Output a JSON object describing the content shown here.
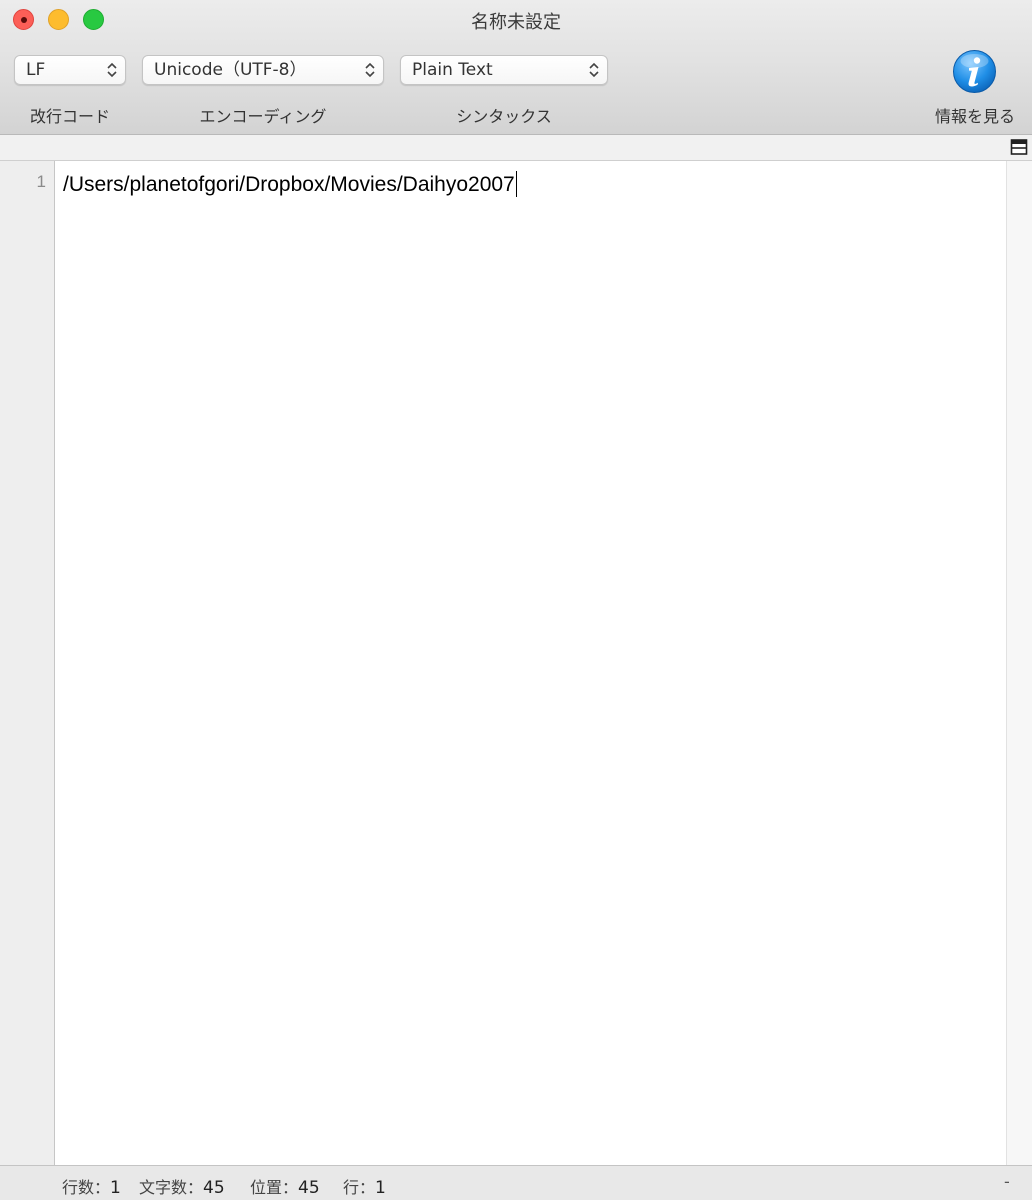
{
  "window": {
    "title": "名称未設定"
  },
  "toolbar": {
    "line_ending": {
      "value": "LF",
      "label": "改行コード"
    },
    "encoding": {
      "value": "Unicode（UTF-8）",
      "label": "エンコーディング"
    },
    "syntax": {
      "value": "Plain Text",
      "label": "シンタックス"
    },
    "info": {
      "label": "情報を見る",
      "icon": "info-icon",
      "color": "#1f8ee6"
    }
  },
  "editor": {
    "lines": [
      {
        "number": "1",
        "text": "/Users/planetofgori/Dropbox/Movies/Daihyo2007"
      }
    ]
  },
  "status": {
    "lines_label": "行数：",
    "lines_value": "1",
    "chars_label": "文字数：",
    "chars_value": "45",
    "position_label": "位置：",
    "position_value": "45",
    "row_label": "行：",
    "row_value": "1",
    "right_mark": "-"
  }
}
